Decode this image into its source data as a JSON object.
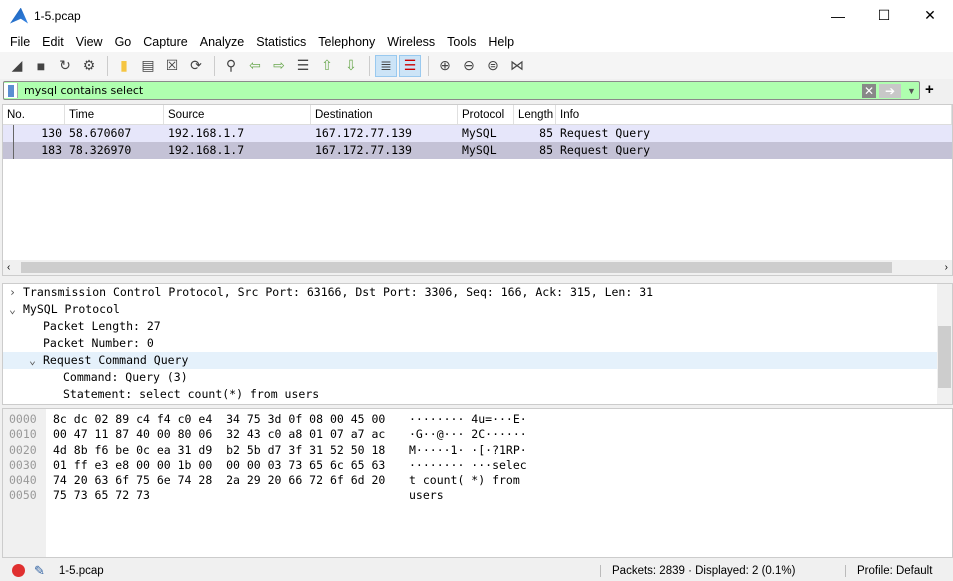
{
  "window": {
    "title": "1-5.pcap"
  },
  "menu": [
    "File",
    "Edit",
    "View",
    "Go",
    "Capture",
    "Analyze",
    "Statistics",
    "Telephony",
    "Wireless",
    "Tools",
    "Help"
  ],
  "toolbar": [
    "start-capture",
    "stop-capture",
    "restart-capture",
    "capture-options",
    "open-file",
    "save-file",
    "close-file",
    "reload-file",
    "find-packet",
    "go-back",
    "go-forward",
    "go-to-packet",
    "first-packet",
    "last-packet",
    "auto-scroll",
    "colorize",
    "zoom-in",
    "zoom-out",
    "normal-size",
    "resize-columns"
  ],
  "filter": {
    "value": "mysql contains select"
  },
  "columns": [
    "No.",
    "Time",
    "Source",
    "Destination",
    "Protocol",
    "Length",
    "Info"
  ],
  "packets": [
    [
      "130",
      "58.670607",
      "192.168.1.7",
      "167.172.77.139",
      "MySQL",
      "85",
      "Request Query"
    ],
    [
      "183",
      "78.326970",
      "192.168.1.7",
      "167.172.77.139",
      "MySQL",
      "85",
      "Request Query"
    ]
  ],
  "details": [
    {
      "text": "Transmission Control Protocol, Src Port: 63166, Dst Port: 3306, Seq: 166, Ack: 315, Len: 31",
      "indent": 0,
      "toggle": ">"
    },
    {
      "text": "MySQL Protocol",
      "indent": 0,
      "toggle": "v"
    },
    {
      "text": "Packet Length: 27",
      "indent": 1,
      "toggle": ""
    },
    {
      "text": "Packet Number: 0",
      "indent": 1,
      "toggle": ""
    },
    {
      "text": "Request Command Query",
      "indent": 1,
      "toggle": "v",
      "selected": true
    },
    {
      "text": "Command: Query (3)",
      "indent": 2,
      "toggle": ""
    },
    {
      "text": "Statement: select count(*) from users",
      "indent": 2,
      "toggle": ""
    }
  ],
  "bytes": {
    "offsets": [
      "0000",
      "0010",
      "0020",
      "0030",
      "0040",
      "0050"
    ],
    "hex": [
      "8c dc 02 89 c4 f4 c0 e4  34 75 3d 0f 08 00 45 00",
      "00 47 11 87 40 00 80 06  32 43 c0 a8 01 07 a7 ac",
      "4d 8b f6 be 0c ea 31 d9  b2 5b d7 3f 31 52 50 18",
      "01 ff e3 e8 00 00 1b 00  00 00 03 73 65 6c 65 63",
      "74 20 63 6f 75 6e 74 28  2a 29 20 66 72 6f 6d 20",
      "75 73 65 72 73"
    ],
    "ascii": [
      "········ 4u=···E·",
      "·G··@··· 2C······",
      "M·····1· ·[·?1RP·",
      "········ ···selec",
      "t count( *) from ",
      "users"
    ]
  },
  "status": {
    "file": "1-5.pcap",
    "packets": "Packets: 2839 · Displayed: 2 (0.1%)",
    "profile": "Profile: Default"
  },
  "colors": {
    "filter_ok": "#afffaf",
    "row1": "#e6e6fa",
    "row2": "#c4c2d6",
    "selected_detail": "#e5f1fb"
  }
}
